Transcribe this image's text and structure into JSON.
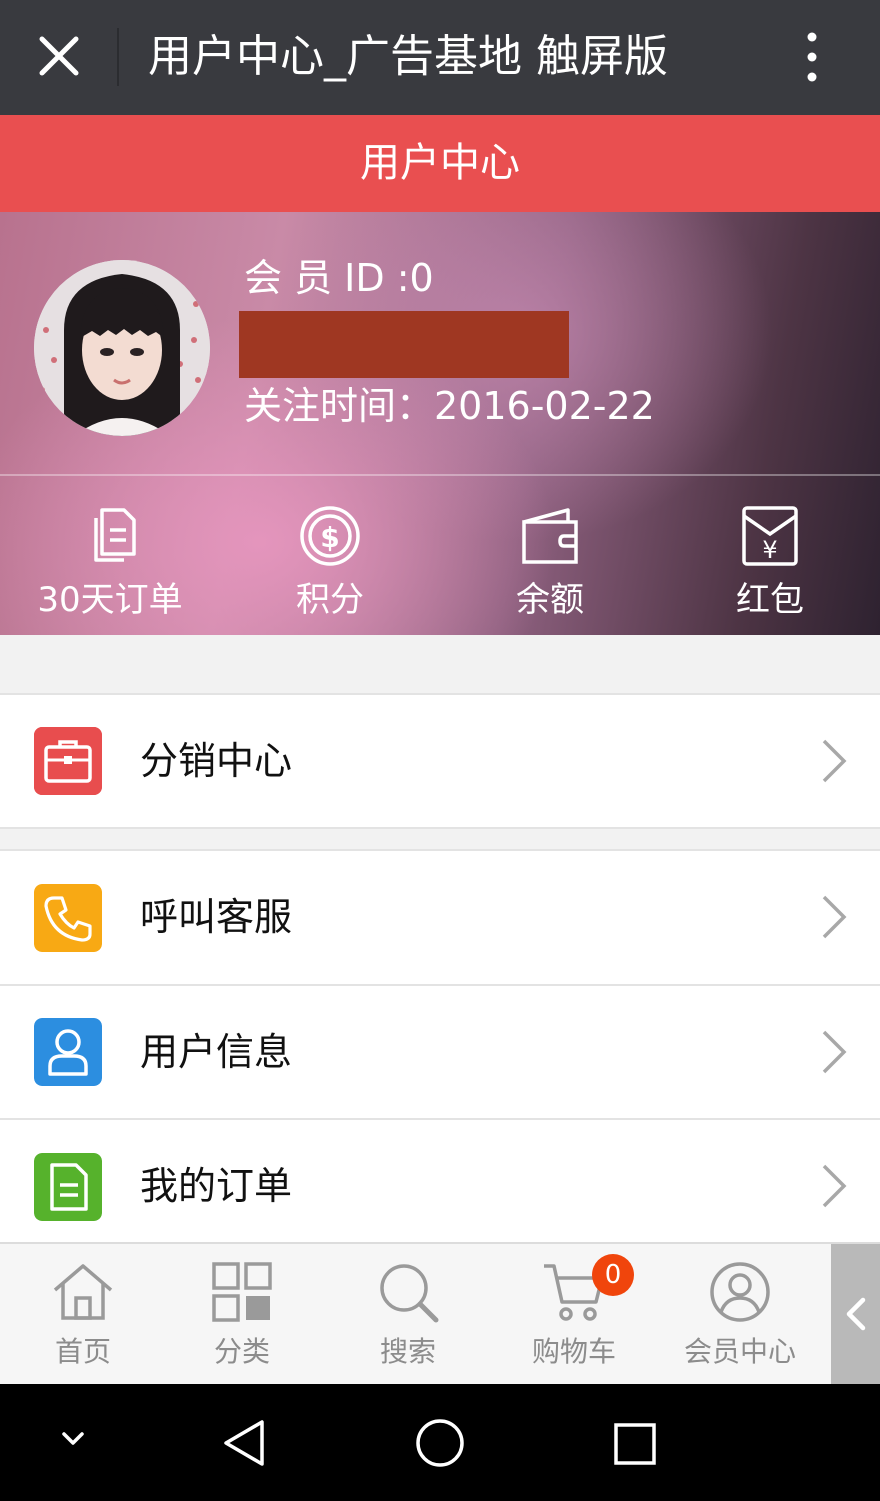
{
  "titlebar": {
    "title": "用户中心_广告基地 触屏版",
    "close_icon": "close-icon",
    "more_icon": "more-vertical-icon"
  },
  "header": {
    "title": "用户中心"
  },
  "profile": {
    "member_id": "会 员 ID :0",
    "follow_date": "关注时间：2016-02-22"
  },
  "stats": [
    {
      "label": "30天订单",
      "icon": "document-icon"
    },
    {
      "label": "积分",
      "icon": "dollar-coin-icon"
    },
    {
      "label": "余额",
      "icon": "wallet-icon"
    },
    {
      "label": "红包",
      "icon": "red-envelope-icon"
    }
  ],
  "menu": [
    {
      "label": "分销中心",
      "icon": "briefcase-icon",
      "color": "#e84d4e"
    },
    {
      "label": "呼叫客服",
      "icon": "phone-icon",
      "color": "#f8a914"
    },
    {
      "label": "用户信息",
      "icon": "user-icon",
      "color": "#2c8ee0"
    },
    {
      "label": "我的订单",
      "icon": "order-document-icon",
      "color": "#56b22c"
    }
  ],
  "tabbar": [
    {
      "label": "首页",
      "icon": "home-icon"
    },
    {
      "label": "分类",
      "icon": "grid-icon"
    },
    {
      "label": "搜索",
      "icon": "search-icon"
    },
    {
      "label": "购物车",
      "icon": "cart-icon"
    },
    {
      "label": "会员中心",
      "icon": "user-circle-icon"
    }
  ],
  "cart_badge": "0",
  "colors": {
    "titlebar": "#393a3f",
    "header": "#e94f50",
    "badge": "#f0450c"
  }
}
